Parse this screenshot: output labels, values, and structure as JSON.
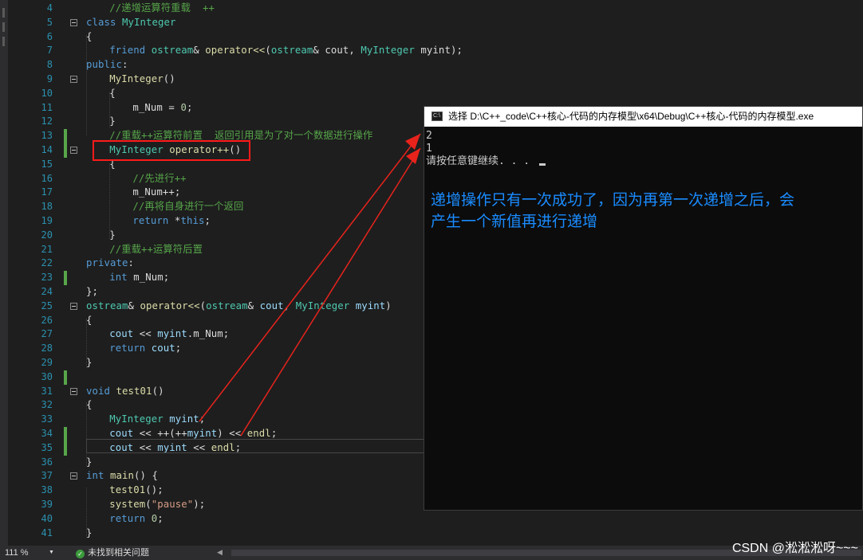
{
  "editor": {
    "lines": [
      {
        "no": "4",
        "indent": "    ",
        "tokens": [
          {
            "t": "//递增运算符重载  ++",
            "c": "c"
          }
        ]
      },
      {
        "no": "5",
        "indent": "",
        "fold": true,
        "tokens": [
          {
            "t": "class ",
            "c": "k"
          },
          {
            "t": "MyInteger",
            "c": "t"
          }
        ]
      },
      {
        "no": "6",
        "indent": "",
        "tokens": [
          {
            "t": "{",
            "c": "p"
          }
        ]
      },
      {
        "no": "7",
        "indent": "    ",
        "tokens": [
          {
            "t": "friend ",
            "c": "k"
          },
          {
            "t": "ostream",
            "c": "t"
          },
          {
            "t": "& ",
            "c": "p"
          },
          {
            "t": "operator<<",
            "c": "f"
          },
          {
            "t": "(",
            "c": "p"
          },
          {
            "t": "ostream",
            "c": "t"
          },
          {
            "t": "& cout, ",
            "c": "p"
          },
          {
            "t": "MyInteger",
            "c": "t"
          },
          {
            "t": " myint);",
            "c": "p"
          }
        ]
      },
      {
        "no": "8",
        "indent": "",
        "tokens": [
          {
            "t": "public",
            "c": "k"
          },
          {
            "t": ":",
            "c": "p"
          }
        ]
      },
      {
        "no": "9",
        "indent": "    ",
        "fold": true,
        "tokens": [
          {
            "t": "MyInteger",
            "c": "f"
          },
          {
            "t": "()",
            "c": "p"
          }
        ]
      },
      {
        "no": "10",
        "indent": "    ",
        "tokens": [
          {
            "t": "{",
            "c": "p"
          }
        ]
      },
      {
        "no": "11",
        "indent": "        ",
        "tokens": [
          {
            "t": "m_Num",
            "c": "m2"
          },
          {
            "t": " = ",
            "c": "p"
          },
          {
            "t": "0",
            "c": "n"
          },
          {
            "t": ";",
            "c": "p"
          }
        ]
      },
      {
        "no": "12",
        "indent": "    ",
        "tokens": [
          {
            "t": "}",
            "c": "p"
          }
        ]
      },
      {
        "no": "13",
        "indent": "    ",
        "chg": true,
        "tokens": [
          {
            "t": "//重载++运算符前置  返回引用是为了对一个数据进行操作",
            "c": "c"
          }
        ]
      },
      {
        "no": "14",
        "indent": "    ",
        "fold": true,
        "chg": true,
        "tokens": [
          {
            "t": "MyInteger ",
            "c": "t"
          },
          {
            "t": "operator++",
            "c": "f"
          },
          {
            "t": "()",
            "c": "p"
          }
        ]
      },
      {
        "no": "15",
        "indent": "    ",
        "tokens": [
          {
            "t": "{",
            "c": "p"
          }
        ]
      },
      {
        "no": "16",
        "indent": "        ",
        "tokens": [
          {
            "t": "//先进行++",
            "c": "c"
          }
        ]
      },
      {
        "no": "17",
        "indent": "        ",
        "tokens": [
          {
            "t": "m_Num",
            "c": "m2"
          },
          {
            "t": "++;",
            "c": "p"
          }
        ]
      },
      {
        "no": "18",
        "indent": "        ",
        "tokens": [
          {
            "t": "//再将自身进行一个返回",
            "c": "c"
          }
        ]
      },
      {
        "no": "19",
        "indent": "        ",
        "tokens": [
          {
            "t": "return ",
            "c": "k"
          },
          {
            "t": "*",
            "c": "p"
          },
          {
            "t": "this",
            "c": "k"
          },
          {
            "t": ";",
            "c": "p"
          }
        ]
      },
      {
        "no": "20",
        "indent": "    ",
        "tokens": [
          {
            "t": "}",
            "c": "p"
          }
        ]
      },
      {
        "no": "21",
        "indent": "    ",
        "tokens": [
          {
            "t": "//重载++运算符后置",
            "c": "c"
          }
        ]
      },
      {
        "no": "22",
        "indent": "",
        "tokens": [
          {
            "t": "private",
            "c": "k"
          },
          {
            "t": ":",
            "c": "p"
          }
        ]
      },
      {
        "no": "23",
        "indent": "    ",
        "chg": true,
        "tokens": [
          {
            "t": "int ",
            "c": "k"
          },
          {
            "t": "m_Num",
            "c": "m2"
          },
          {
            "t": ";",
            "c": "p"
          }
        ]
      },
      {
        "no": "24",
        "indent": "",
        "tokens": [
          {
            "t": "};",
            "c": "p"
          }
        ]
      },
      {
        "no": "25",
        "indent": "",
        "fold": true,
        "tokens": [
          {
            "t": "ostream",
            "c": "t"
          },
          {
            "t": "& ",
            "c": "p"
          },
          {
            "t": "operator<<",
            "c": "f"
          },
          {
            "t": "(",
            "c": "p"
          },
          {
            "t": "ostream",
            "c": "t"
          },
          {
            "t": "& ",
            "c": "p"
          },
          {
            "t": "cout",
            "c": "v"
          },
          {
            "t": ", ",
            "c": "p"
          },
          {
            "t": "MyInteger",
            "c": "t"
          },
          {
            "t": " ",
            "c": "p"
          },
          {
            "t": "myint",
            "c": "v"
          },
          {
            "t": ")",
            "c": "p"
          }
        ]
      },
      {
        "no": "26",
        "indent": "",
        "tokens": [
          {
            "t": "{",
            "c": "p"
          }
        ]
      },
      {
        "no": "27",
        "indent": "    ",
        "tokens": [
          {
            "t": "cout",
            "c": "v"
          },
          {
            "t": " << ",
            "c": "p"
          },
          {
            "t": "myint",
            "c": "v"
          },
          {
            "t": ".m_Num;",
            "c": "p"
          }
        ]
      },
      {
        "no": "28",
        "indent": "    ",
        "tokens": [
          {
            "t": "return ",
            "c": "k"
          },
          {
            "t": "cout",
            "c": "v"
          },
          {
            "t": ";",
            "c": "p"
          }
        ]
      },
      {
        "no": "29",
        "indent": "",
        "tokens": [
          {
            "t": "}",
            "c": "p"
          }
        ]
      },
      {
        "no": "30",
        "indent": "",
        "chg": true,
        "tokens": []
      },
      {
        "no": "31",
        "indent": "",
        "fold": true,
        "tokens": [
          {
            "t": "void ",
            "c": "k"
          },
          {
            "t": "test01",
            "c": "f"
          },
          {
            "t": "()",
            "c": "p"
          }
        ]
      },
      {
        "no": "32",
        "indent": "",
        "tokens": [
          {
            "t": "{",
            "c": "p"
          }
        ]
      },
      {
        "no": "33",
        "indent": "    ",
        "tokens": [
          {
            "t": "MyInteger ",
            "c": "t"
          },
          {
            "t": "myint",
            "c": "v"
          },
          {
            "t": ";",
            "c": "p"
          }
        ]
      },
      {
        "no": "34",
        "indent": "    ",
        "chg": true,
        "tokens": [
          {
            "t": "cout",
            "c": "v"
          },
          {
            "t": " << ++(++",
            "c": "p"
          },
          {
            "t": "myint",
            "c": "v"
          },
          {
            "t": ") << ",
            "c": "p"
          },
          {
            "t": "endl",
            "c": "f"
          },
          {
            "t": ";",
            "c": "p"
          }
        ]
      },
      {
        "no": "35",
        "indent": "    ",
        "chg": true,
        "tokens": [
          {
            "t": "cout",
            "c": "v"
          },
          {
            "t": " << ",
            "c": "p"
          },
          {
            "t": "myint",
            "c": "v"
          },
          {
            "t": " << ",
            "c": "p"
          },
          {
            "t": "endl",
            "c": "f"
          },
          {
            "t": ";",
            "c": "p"
          }
        ]
      },
      {
        "no": "36",
        "indent": "",
        "tokens": [
          {
            "t": "}",
            "c": "p"
          }
        ]
      },
      {
        "no": "37",
        "indent": "",
        "fold": true,
        "tokens": [
          {
            "t": "int ",
            "c": "k"
          },
          {
            "t": "main",
            "c": "f"
          },
          {
            "t": "() {",
            "c": "p"
          }
        ]
      },
      {
        "no": "38",
        "indent": "    ",
        "tokens": [
          {
            "t": "test01",
            "c": "f"
          },
          {
            "t": "();",
            "c": "p"
          }
        ]
      },
      {
        "no": "39",
        "indent": "    ",
        "tokens": [
          {
            "t": "system",
            "c": "f"
          },
          {
            "t": "(",
            "c": "p"
          },
          {
            "t": "\"pause\"",
            "c": "s"
          },
          {
            "t": ");",
            "c": "p"
          }
        ]
      },
      {
        "no": "40",
        "indent": "    ",
        "tokens": [
          {
            "t": "return ",
            "c": "k"
          },
          {
            "t": "0",
            "c": "n"
          },
          {
            "t": ";",
            "c": "p"
          }
        ]
      },
      {
        "no": "41",
        "indent": "",
        "tokens": [
          {
            "t": "}",
            "c": "p"
          }
        ]
      }
    ]
  },
  "console": {
    "icon_text": "C:\\",
    "title": "选择 D:\\C++_code\\C++核心-代码的内存模型\\x64\\Debug\\C++核心-代码的内存模型.exe",
    "output_lines": [
      "2",
      "1",
      "请按任意键继续. . . "
    ]
  },
  "annotation": {
    "text": "递增操作只有一次成功了，因为再第一次递增之后，会产生一个新值再进行递增"
  },
  "statusbar": {
    "zoom": "111 %",
    "issues": "未找到相关问题"
  },
  "watermark": "CSDN @淞淞淞呀~~~",
  "colors": {
    "background": "#1e1e1e",
    "annotation_blue": "#1a8cff",
    "highlight_red": "#ff1a1a",
    "change_green": "#57a64a"
  }
}
